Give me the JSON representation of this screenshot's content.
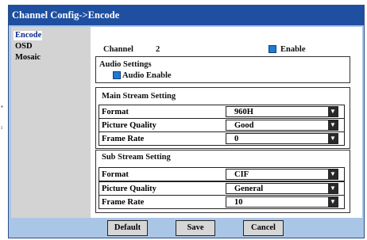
{
  "window": {
    "title": "Channel Config->Encode"
  },
  "sidebar": {
    "items": [
      {
        "label": "Encode"
      },
      {
        "label": "OSD"
      },
      {
        "label": "Mosaic"
      }
    ]
  },
  "channel": {
    "label": "Channel",
    "value": "2",
    "enable_label": "Enable"
  },
  "audio": {
    "title": "Audio Settings",
    "enable_label": "Audio Enable"
  },
  "main_stream": {
    "title": "Main Stream Setting",
    "rows": [
      {
        "label": "Format",
        "value": "960H"
      },
      {
        "label": "Picture Quality",
        "value": "Good"
      },
      {
        "label": "Frame Rate",
        "value": "0"
      }
    ]
  },
  "sub_stream": {
    "title": "Sub Stream Setting",
    "rows": [
      {
        "label": "Format",
        "value": "CIF"
      },
      {
        "label": "Picture Quality",
        "value": "General"
      },
      {
        "label": "Frame Rate",
        "value": "10"
      }
    ]
  },
  "buttons": {
    "default": "Default",
    "save": "Save",
    "cancel": "Cancel"
  },
  "colors": {
    "titlebar": "#1f4fa0",
    "dialog_bg": "#aac6e6",
    "checkbox": "#1f7ad4",
    "sidebar_bg": "#d3d3d3"
  },
  "icons": {
    "dropdown": "triangle-down-icon",
    "checkbox": "checked-square-icon"
  }
}
